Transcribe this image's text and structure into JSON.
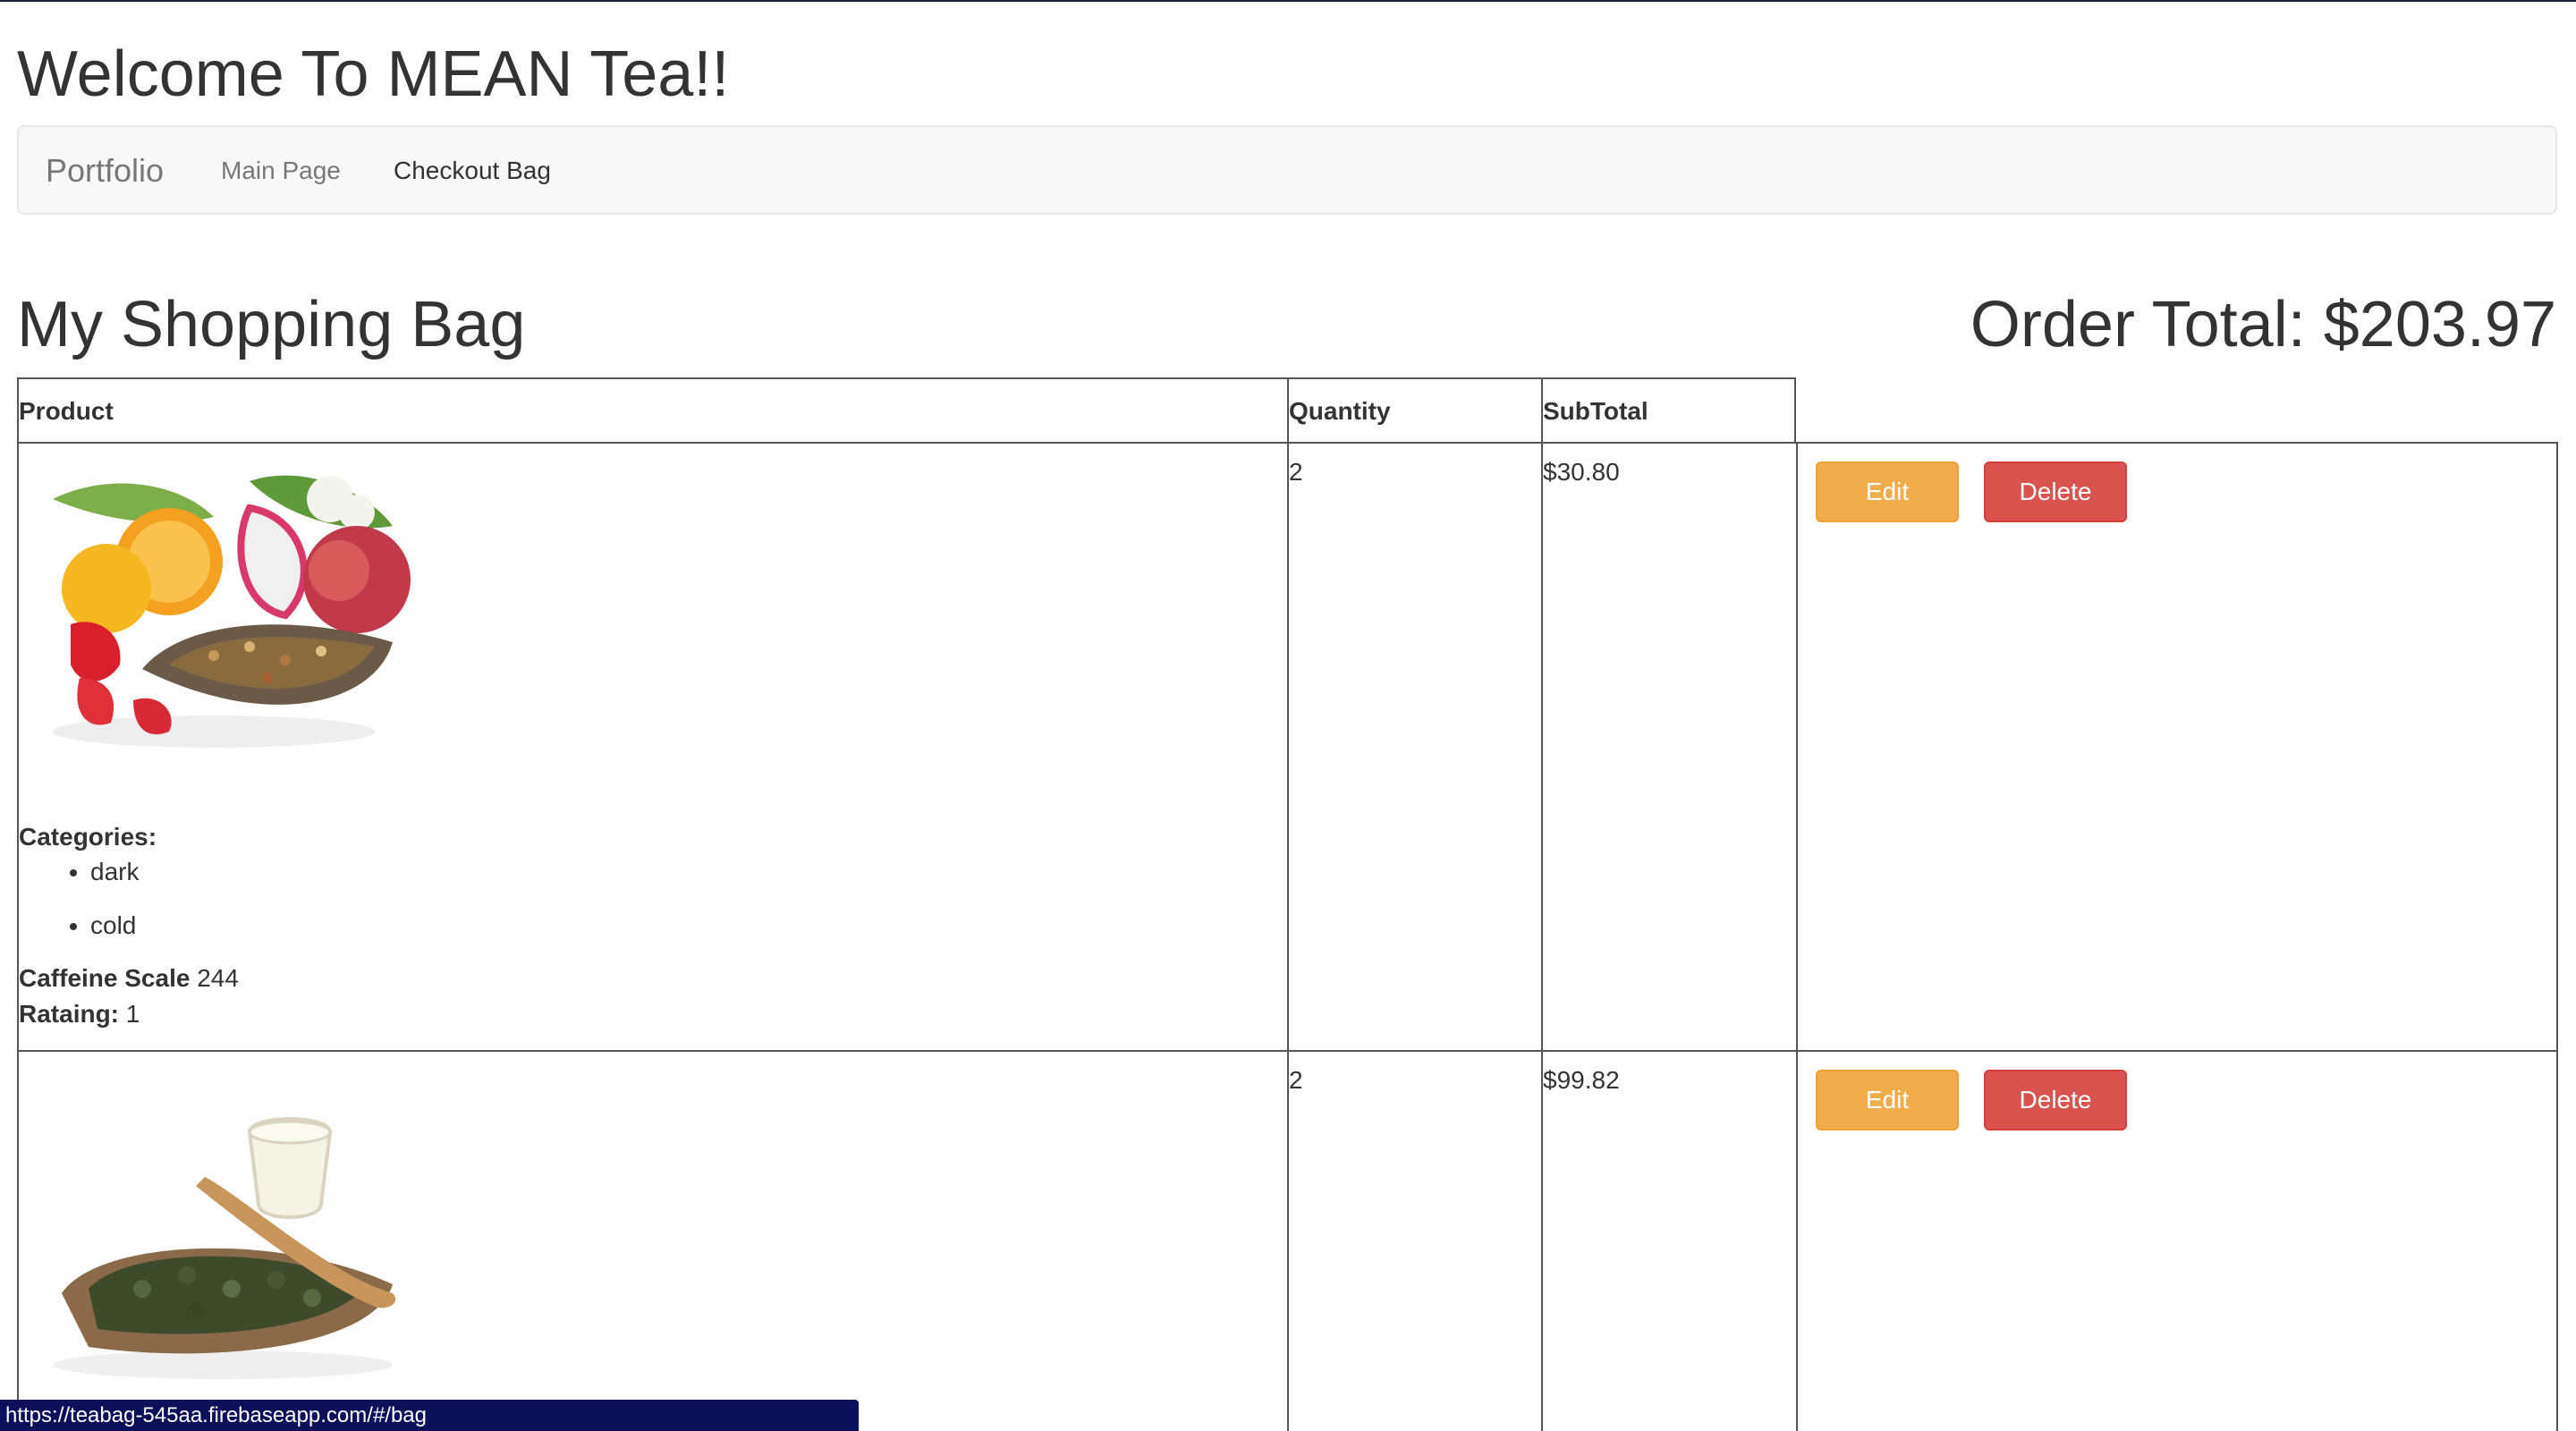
{
  "header": {
    "title": "Welcome To MEAN Tea!!"
  },
  "navbar": {
    "brand": "Portfolio",
    "links": [
      {
        "label": "Main Page",
        "active": false
      },
      {
        "label": "Checkout Bag",
        "active": true
      }
    ]
  },
  "bag": {
    "title": "My Shopping Bag",
    "order_total": "Order Total: $203.97",
    "columns": [
      "Product",
      "Quantity",
      "SubTotal"
    ],
    "items": [
      {
        "image_icon": "fruit-tea-image",
        "categories_label": "Categories:",
        "categories": [
          "dark",
          "cold"
        ],
        "caffeine_label": "Caffeine Scale",
        "caffeine": "244",
        "rating_label": "Rataing:",
        "rating": "1",
        "quantity": "2",
        "subtotal": "$30.80",
        "edit_label": "Edit",
        "delete_label": "Delete"
      },
      {
        "image_icon": "green-tea-image",
        "quantity": "2",
        "subtotal": "$99.82",
        "edit_label": "Edit",
        "delete_label": "Delete"
      }
    ]
  },
  "status_bar": {
    "url": "https://teabag-545aa.firebaseapp.com/#/bag"
  },
  "colors": {
    "edit": "#f0ad4e",
    "delete": "#d9534f",
    "status_bar": "#0d0f5a"
  }
}
